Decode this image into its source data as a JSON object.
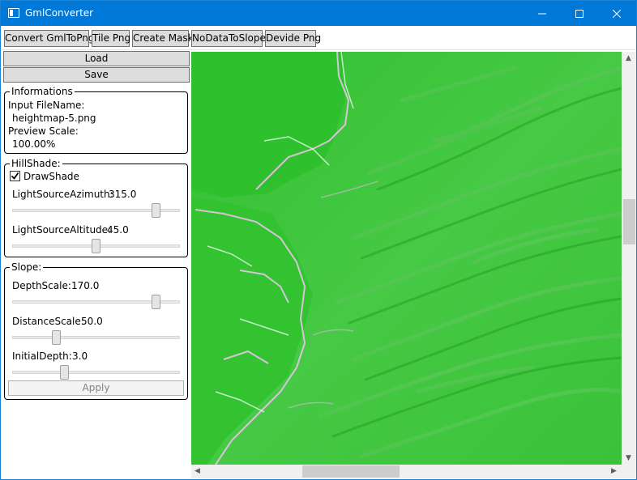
{
  "window": {
    "title": "GmlConverter",
    "colors": {
      "titlebar": "#0078d7",
      "map_base": "#3cc43a",
      "map_highlight": "#e8b4f0"
    }
  },
  "toolbar": {
    "buttons": [
      {
        "label": "Convert GmlToPng"
      },
      {
        "label": "Tile Png"
      },
      {
        "label": "Create Mask"
      },
      {
        "label": "NoDataToSlope"
      },
      {
        "label": "Devide Png"
      }
    ]
  },
  "actions": {
    "load": "Load",
    "save": "Save"
  },
  "informations": {
    "title": "Informations",
    "input_filename_label": "Input FileName:",
    "input_filename_value": "heightmap-5.png",
    "preview_scale_label": "Preview Scale:",
    "preview_scale_value": "100.00%"
  },
  "hillshade": {
    "title": "HillShade:",
    "draw_shade_label": "DrawShade",
    "draw_shade_checked": true,
    "azimuth_label": "LightSourceAzimuth:",
    "azimuth_value": "315.0",
    "azimuth_fraction": 0.875,
    "altitude_label": "LightSourceAltitude:",
    "altitude_value": "45.0",
    "altitude_fraction": 0.5
  },
  "slope": {
    "title": "Slope:",
    "depth_label": "DepthScale:",
    "depth_value": "170.0",
    "depth_fraction": 0.88,
    "distance_label": "DistanceScale:",
    "distance_value": "50.0",
    "distance_fraction": 0.25,
    "initial_label": "InitialDepth:",
    "initial_value": "3.0",
    "initial_fraction": 0.3,
    "apply_label": "Apply"
  }
}
